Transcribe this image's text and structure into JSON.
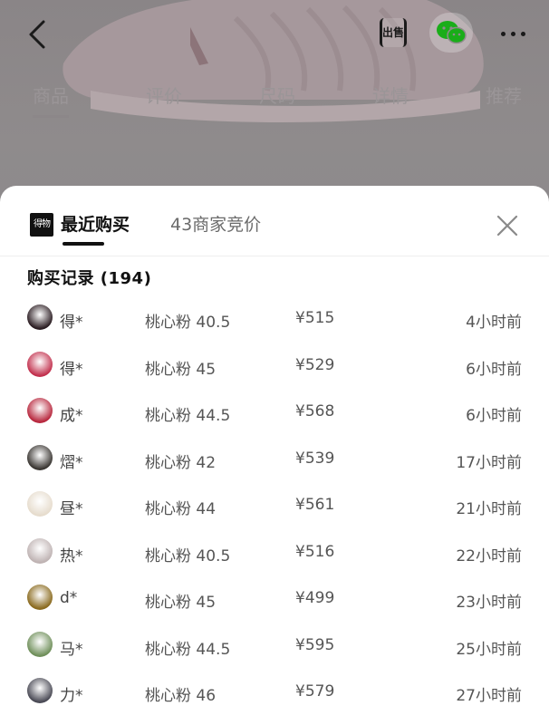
{
  "product_page": {
    "tabs": [
      {
        "label": "商品"
      },
      {
        "label": "评价"
      },
      {
        "label": "尺码"
      },
      {
        "label": "详情"
      },
      {
        "label": "推荐"
      }
    ],
    "sell_badge": "出售"
  },
  "sheet": {
    "brand_logo_text": "得物",
    "tabs": [
      {
        "label": "最近购买"
      },
      {
        "label": "43商家竞价"
      }
    ],
    "record_title": "购买记录 (194)",
    "records": [
      {
        "name": "得*",
        "spec": "桃心粉 40.5",
        "price": "¥515",
        "time": "4小时前",
        "avatar_color": "#2b1d22"
      },
      {
        "name": "得*",
        "spec": "桃心粉 45",
        "price": "¥529",
        "time": "6小时前",
        "avatar_color": "#c2304d"
      },
      {
        "name": "成*",
        "spec": "桃心粉 44.5",
        "price": "¥568",
        "time": "6小时前",
        "avatar_color": "#b8283e"
      },
      {
        "name": "熠*",
        "spec": "桃心粉 42",
        "price": "¥539",
        "time": "17小时前",
        "avatar_color": "#3a3632"
      },
      {
        "name": "昼*",
        "spec": "桃心粉 44",
        "price": "¥561",
        "time": "21小时前",
        "avatar_color": "#e6dccd"
      },
      {
        "name": "热*",
        "spec": "桃心粉 40.5",
        "price": "¥516",
        "time": "22小时前",
        "avatar_color": "#bfb3b3"
      },
      {
        "name": "d*",
        "spec": "桃心粉 45",
        "price": "¥499",
        "time": "23小时前",
        "avatar_color": "#8a6a1e"
      },
      {
        "name": "马*",
        "spec": "桃心粉 44.5",
        "price": "¥595",
        "time": "25小时前",
        "avatar_color": "#6f8f5a"
      },
      {
        "name": "力*",
        "spec": "桃心粉 46",
        "price": "¥579",
        "time": "27小时前",
        "avatar_color": "#4a4a55"
      }
    ]
  },
  "colors": {
    "overlay": "#7d7b7c",
    "sheet_bg": "#ffffff",
    "text_primary": "#111111",
    "text_secondary": "#555555",
    "wechat_green": "#1aad19"
  }
}
